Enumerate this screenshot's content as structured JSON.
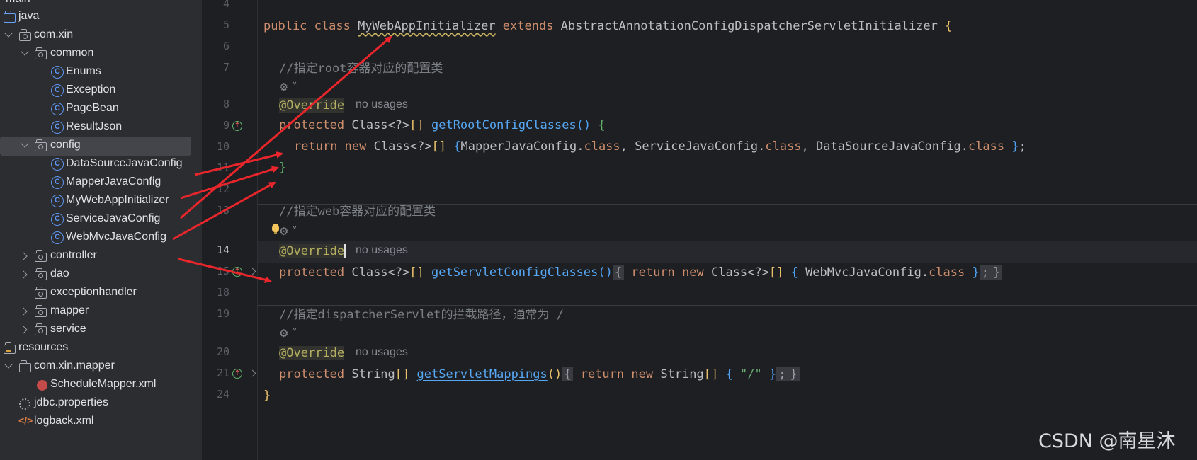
{
  "tree": {
    "items": [
      {
        "label": "main",
        "icon": "folder-icon"
      },
      {
        "label": "java",
        "icon": "source-folder-icon"
      },
      {
        "label": "com.xin",
        "icon": "package-icon"
      },
      {
        "label": "common",
        "icon": "package-icon"
      },
      {
        "label": "Enums",
        "icon": "class-icon"
      },
      {
        "label": "Exception",
        "icon": "class-icon"
      },
      {
        "label": "PageBean",
        "icon": "class-icon"
      },
      {
        "label": "ResultJson",
        "icon": "class-icon"
      },
      {
        "label": "config",
        "icon": "package-icon"
      },
      {
        "label": "DataSourceJavaConfig",
        "icon": "class-icon"
      },
      {
        "label": "MapperJavaConfig",
        "icon": "class-icon"
      },
      {
        "label": "MyWebAppInitializer",
        "icon": "class-icon"
      },
      {
        "label": "ServiceJavaConfig",
        "icon": "class-icon"
      },
      {
        "label": "WebMvcJavaConfig",
        "icon": "class-icon"
      },
      {
        "label": "controller",
        "icon": "package-icon"
      },
      {
        "label": "dao",
        "icon": "package-icon"
      },
      {
        "label": "exceptionhandler",
        "icon": "package-icon"
      },
      {
        "label": "mapper",
        "icon": "package-icon"
      },
      {
        "label": "service",
        "icon": "package-icon"
      },
      {
        "label": "resources",
        "icon": "resources-folder-icon"
      },
      {
        "label": "com.xin.mapper",
        "icon": "folder-icon"
      },
      {
        "label": "ScheduleMapper.xml",
        "icon": "xml-file-icon"
      },
      {
        "label": "jdbc.properties",
        "icon": "properties-file-icon"
      },
      {
        "label": "logback.xml",
        "icon": "xml-file-icon"
      }
    ],
    "class_glyph": "C"
  },
  "gutter": {
    "line_numbers": [
      "4",
      "5",
      "6",
      "7",
      "8",
      "9",
      "10",
      "11",
      "12",
      "13",
      "14",
      "15",
      "18",
      "19",
      "20",
      "21",
      "24"
    ]
  },
  "code": {
    "l5": {
      "kw1": "public ",
      "kw2": "class ",
      "cls": "MyWebAppInitializer",
      "kw3": " extends ",
      "sup": "AbstractAnnotationConfigDispatcherServletInitializer ",
      "br": "{"
    },
    "l7": "//指定root容器对应的配置类",
    "ann": "@Override",
    "no_usages": "no usages",
    "l9": {
      "kw": "protected ",
      "ty": "Class<?>",
      "br": "[]",
      "sp": " ",
      "fn": "getRootConfigClasses",
      "p": "()",
      "sp2": " ",
      "ob": "{"
    },
    "l10": {
      "kw1": "return ",
      "kw2": "new ",
      "ty": "Class<?>",
      "br": "[] ",
      "ob": "{",
      "a": "MapperJavaConfig.",
      "c1": "class",
      "b": ", ServiceJavaConfig.",
      "c2": "class",
      "c": ", DataSourceJavaConfig.",
      "c3": "class",
      "sp": " ",
      "cb": "}",
      "end": ";"
    },
    "l11": "}",
    "l13": "//指定web容器对应的配置类",
    "l15": {
      "kw": "protected ",
      "ty": "Class<?>",
      "br": "[]",
      "sp": " ",
      "fn": "getServletConfigClasses",
      "p": "()",
      "f1": "{",
      "kw2": " return ",
      "kw3": "new ",
      "ty2": "Class<?>",
      "br2": "[] ",
      "ob": "{",
      "v": " WebMvcJavaConfig.",
      "c": "class",
      "sp2": " ",
      "cb": "}",
      "end": ";",
      "f2": "}"
    },
    "l19": "//指定dispatcherServlet的拦截路径，通常为 /",
    "l21": {
      "kw": "protected ",
      "ty": "String",
      "br": "[]",
      "sp": " ",
      "fn": "getServletMappings",
      "p": "()",
      "f1": "{",
      "kw2": " return ",
      "kw3": "new ",
      "ty2": "String",
      "br2": "[] ",
      "ob": "{",
      "v": " ",
      "s": "\"/\"",
      "sp2": " ",
      "cb": "}",
      "end": ";",
      "f2": "}"
    },
    "l24": "}",
    "ai_glyph": "⚙"
  },
  "watermark": "CSDN @南星沐",
  "colors": {
    "arrow": "#e8262b",
    "keyword": "#cf8e6d",
    "method": "#56a8f5",
    "annotation": "#b3ae60"
  }
}
